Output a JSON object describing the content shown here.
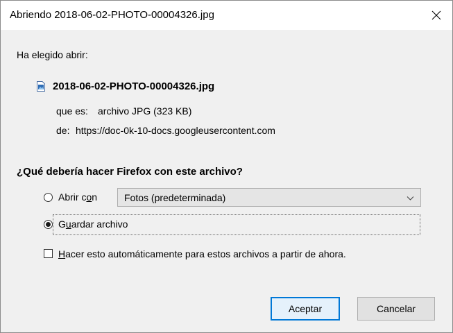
{
  "window": {
    "title": "Abriendo 2018-06-02-PHOTO-00004326.jpg",
    "close_icon": "close-icon"
  },
  "intro": {
    "label": "Ha elegido abrir:"
  },
  "file": {
    "icon": "image-file-icon",
    "name": "2018-06-02-PHOTO-00004326.jpg",
    "type_label": "que es:",
    "type_value": "archivo JPG (323 KB)",
    "from_label": "de:",
    "from_value": "https://doc-0k-10-docs.googleusercontent.com"
  },
  "question": "¿Qué debería hacer Firefox con este archivo?",
  "options": {
    "open_with": {
      "label_pre": "Abrir c",
      "label_mnemonic": "o",
      "label_post": "n",
      "checked": false
    },
    "app_select": {
      "value": "Fotos (predeterminada)",
      "icon": "chevron-down-icon"
    },
    "save": {
      "label_pre": "G",
      "label_mnemonic": "u",
      "label_post": "ardar archivo",
      "checked": true
    },
    "auto": {
      "label_mnemonic": "H",
      "label_post": "acer esto automáticamente para estos archivos a partir de ahora.",
      "checked": false
    }
  },
  "buttons": {
    "accept": "Aceptar",
    "cancel": "Cancelar"
  },
  "colors": {
    "background": "#f0f0f0",
    "titlebar": "#ffffff",
    "accent": "#0078d7",
    "select_bg": "#e5e5e5",
    "button_bg": "#e1e1e1"
  }
}
